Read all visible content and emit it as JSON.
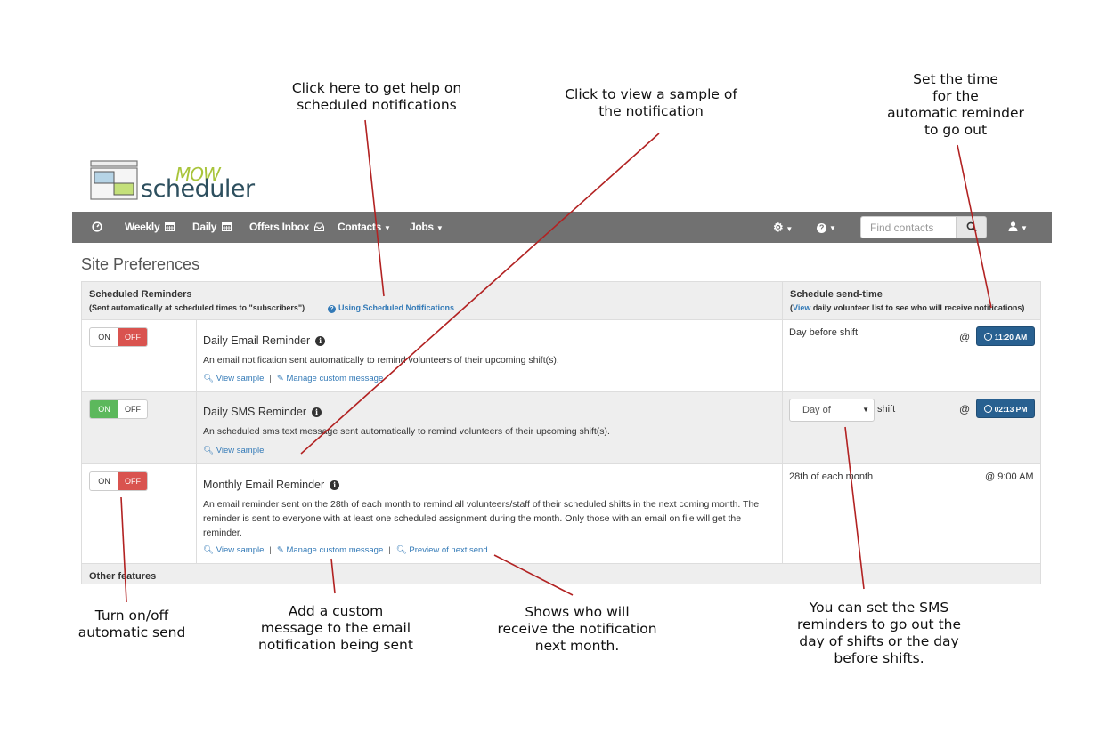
{
  "callouts": {
    "help": "Click here to get help on\nscheduled notifications",
    "sample": "Click to view a sample of\nthe notification",
    "time": "Set the time\nfor the\nautomatic reminder\nto go out",
    "toggle": "Turn on/off\nautomatic send",
    "custom": "Add a custom\nmessage to the email\nnotification being sent",
    "preview": "Shows who will\nreceive the notification\nnext month.",
    "sms": "You can set the SMS\nreminders to go out the\nday of shifts or the day\nbefore shifts."
  },
  "logo": {
    "word1": "MOW",
    "word2": "scheduler"
  },
  "nav": {
    "weekly": "Weekly",
    "daily": "Daily",
    "offers": "Offers Inbox",
    "contacts": "Contacts",
    "jobs": "Jobs",
    "search_placeholder": "Find contacts"
  },
  "page_title": "Site Preferences",
  "panel": {
    "left_header": "Scheduled Reminders",
    "left_sub": "(Sent automatically at scheduled times to \"subscribers\")",
    "help_link": "Using Scheduled Notifications",
    "right_header": "Schedule send-time",
    "right_sub_open": "(",
    "right_sub_link": "View",
    "right_sub_rest": " daily volunteer list to see who will receive notifications)",
    "other_features": "Other features"
  },
  "toggle": {
    "on": "ON",
    "off": "OFF"
  },
  "reminders": [
    {
      "title": "Daily Email Reminder",
      "state": "off",
      "description": "An email notification sent automatically to remind volunteers of their upcoming shift(s).",
      "view_sample": "View sample",
      "manage": "Manage custom message",
      "schedule_text": "Day before shift",
      "time": "11:20 AM"
    },
    {
      "title": "Daily SMS Reminder",
      "state": "on",
      "description": "An scheduled sms text message sent automatically to remind volunteers of their upcoming shift(s).",
      "view_sample": "View sample",
      "schedule_select": "Day of",
      "schedule_suffix": "shift",
      "time": "02:13 PM"
    },
    {
      "title": "Monthly Email Reminder",
      "state": "off",
      "description": "An email reminder sent on the 28th of each month to remind all volunteers/staff of their scheduled shifts in the next coming month. The reminder is sent to everyone with at least one scheduled assignment during the month. Only those with an email on file will get the reminder.",
      "view_sample": "View sample",
      "manage": "Manage custom message",
      "preview": "Preview of next send",
      "schedule_text": "28th of each month",
      "time_text": "@ 9:00 AM"
    }
  ],
  "at_symbol": "@",
  "colors": {
    "navbar": "#717171",
    "off_red": "#d9534f",
    "on_green": "#5cb85c",
    "time_button": "#286090",
    "callout_line": "#b22222",
    "link": "#337ab7"
  }
}
